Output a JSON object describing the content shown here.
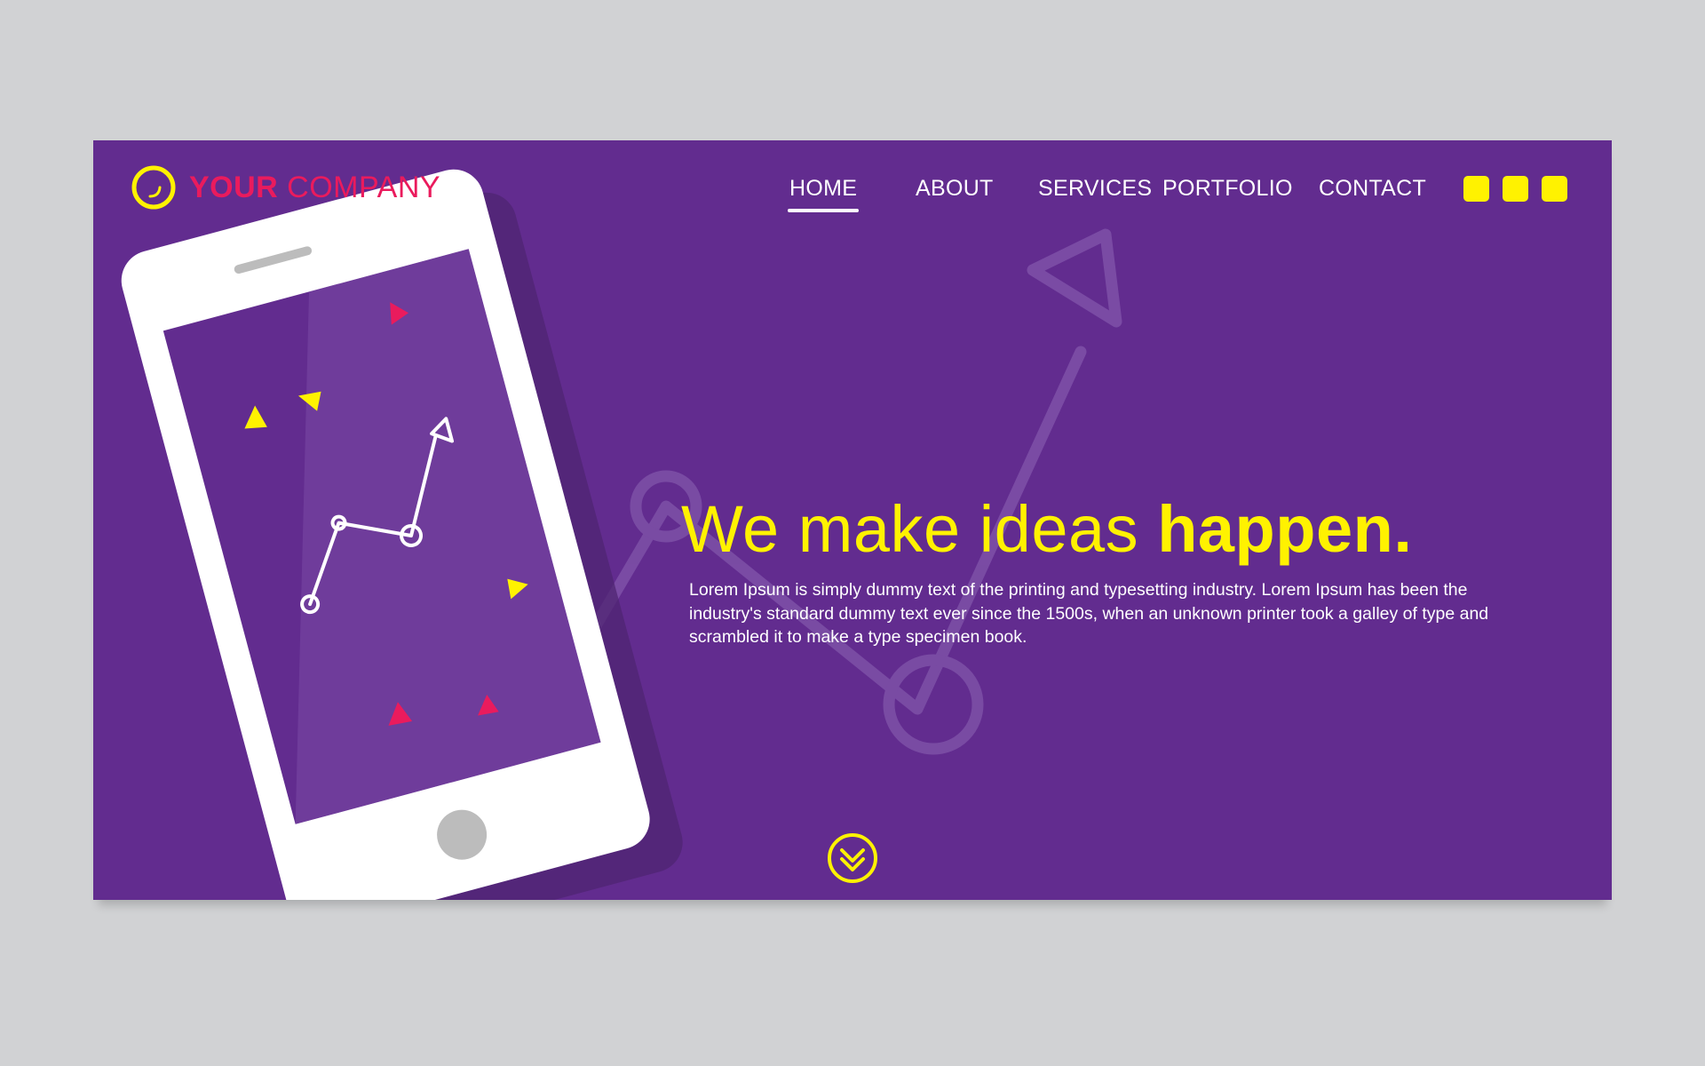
{
  "brand": {
    "name_bold": "YOUR",
    "name_rest": " COMPANY"
  },
  "nav": {
    "items": [
      {
        "label": "HOME",
        "active": true
      },
      {
        "label": "ABOUT",
        "active": false
      },
      {
        "label": "SERVICES",
        "active": false
      },
      {
        "label": "PORTFOLIO",
        "active": false
      },
      {
        "label": "CONTACT",
        "active": false
      }
    ]
  },
  "hero": {
    "headline_light": "We make ideas ",
    "headline_bold": "happen",
    "headline_dot": ".",
    "body": "Lorem Ipsum is simply dummy text of the printing and typesetting industry. Lorem Ipsum has been the industry's standard dummy text ever since the 1500s, when an unknown printer took a galley of type and scrambled it to make a type specimen book."
  },
  "colors": {
    "background": "#622c8f",
    "accent": "#fff200",
    "brand": "#ea1b5d",
    "text": "#ffffff"
  },
  "icons": {
    "logo": "circle-logo-icon",
    "window_controls": [
      "square-icon",
      "square-icon",
      "square-icon"
    ],
    "scroll": "double-chevron-down-icon"
  }
}
